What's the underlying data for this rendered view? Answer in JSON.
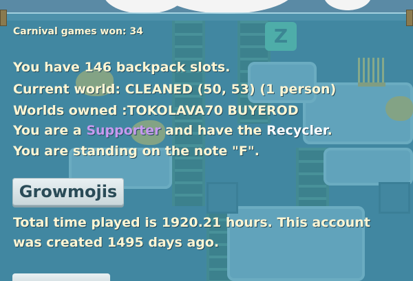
{
  "stats": {
    "carnival": "Carnival games won: 34",
    "backpack": "You have 146 backpack slots.",
    "current_world": "Current world: CLEANED (50, 53) (1 person)",
    "worlds_owned": "Worlds owned :TOKOLAVA70 BUYEROD",
    "supporter_prefix": "You are a ",
    "supporter_word": "Supporter",
    "supporter_middle": " and have the ",
    "recycler_word": "Recycler",
    "supporter_suffix": ".",
    "standing": "You are standing on the note \"F\".",
    "time_played_1": "Total time played is 1920.21 hours.  This account",
    "time_played_2": "was created 1495 days ago."
  },
  "buttons": {
    "growmojis": "Growmojis"
  },
  "world": {
    "z_block_letter": "Z"
  },
  "colors": {
    "text": "#fff6d4",
    "supporter": "#c79af0",
    "panel": "#4696af"
  }
}
